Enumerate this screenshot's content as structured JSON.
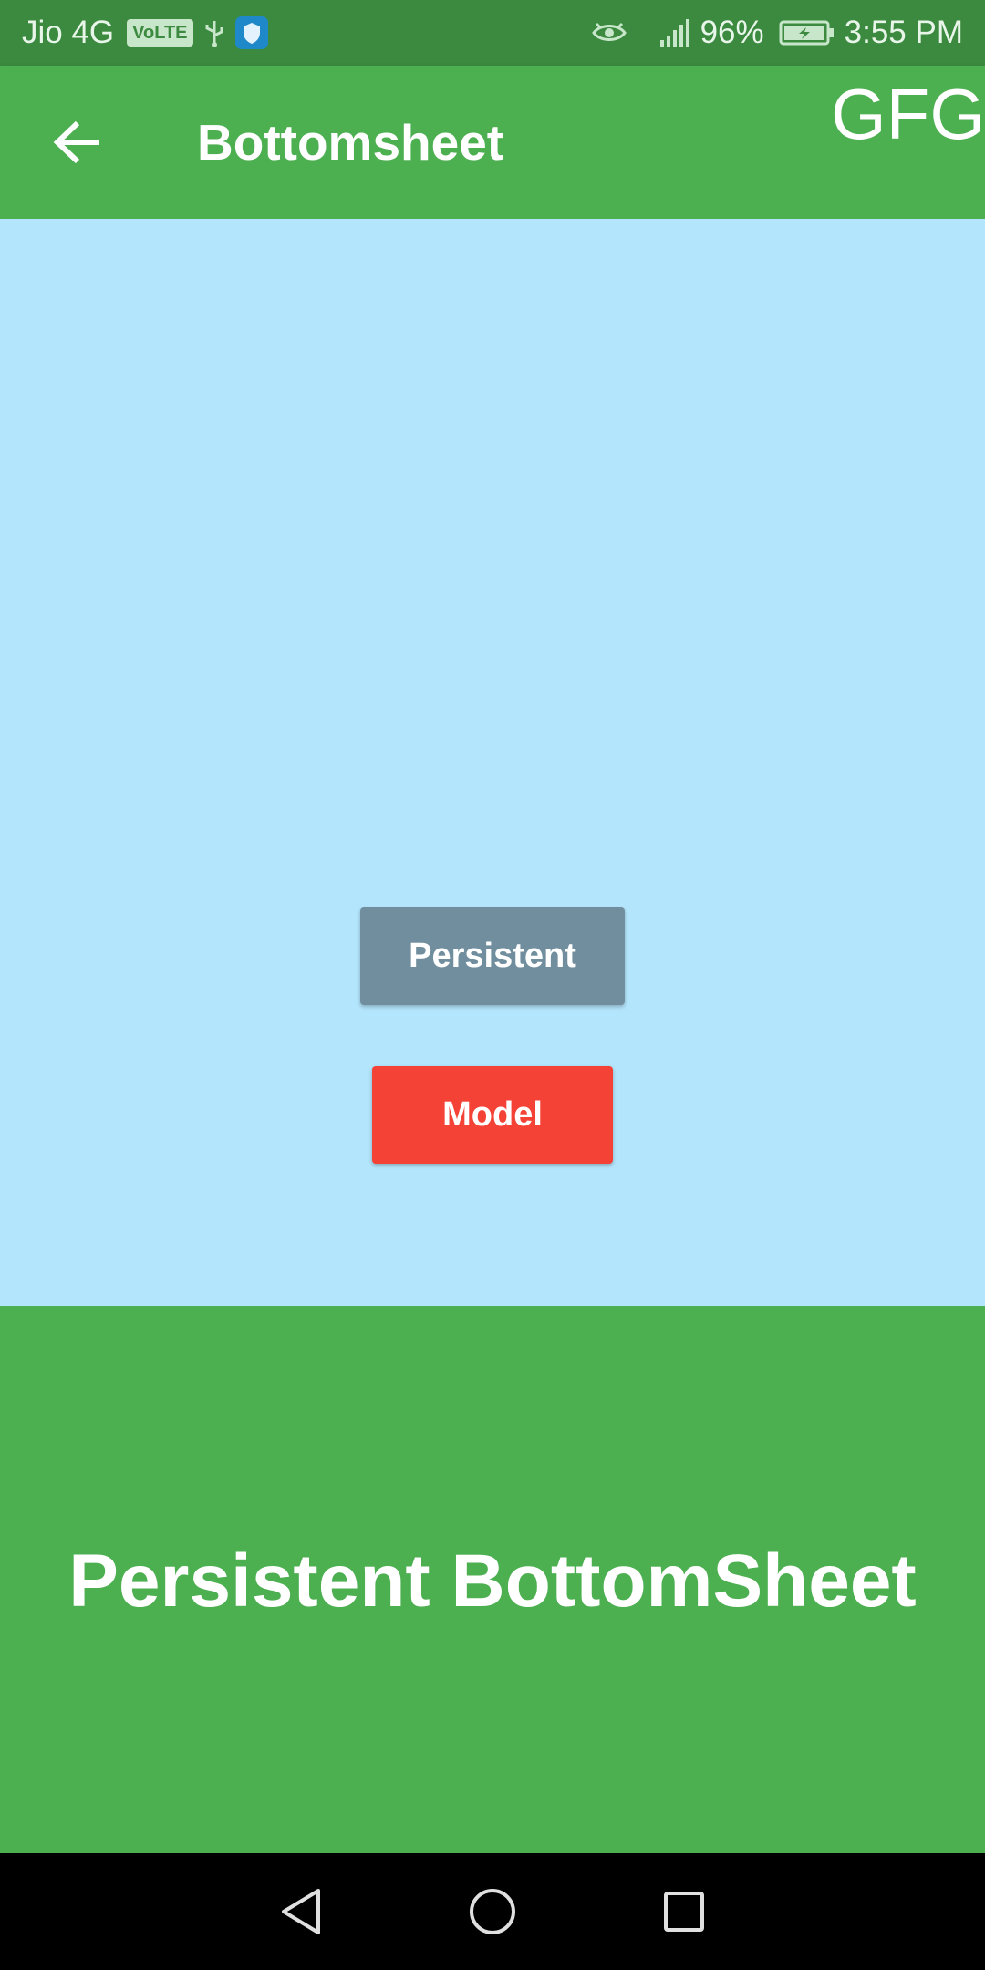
{
  "status_bar": {
    "carrier": "Jio 4G",
    "volte": "VoLTE",
    "battery": "96%",
    "time": "3:55 PM"
  },
  "app_bar": {
    "title": "Bottomsheet",
    "brand": "GFG"
  },
  "buttons": {
    "persistent_label": "Persistent",
    "model_label": "Model"
  },
  "bottom_sheet": {
    "text": "Persistent BottomSheet"
  },
  "colors": {
    "status_bar": "#3b8a40",
    "app_bar": "#4caf50",
    "background": "#b3e5fc",
    "persistent_button": "#718e9e",
    "model_button": "#f44336",
    "bottom_sheet": "#4caf50",
    "nav_bar": "#000000"
  },
  "icons": {
    "usb": "usb-icon",
    "shield": "shield-icon",
    "eye": "eye-icon",
    "signal": "signal-icon",
    "battery": "battery-icon",
    "back": "back-arrow-icon",
    "nav_back": "nav-back-icon",
    "nav_home": "nav-home-icon",
    "nav_recents": "nav-recents-icon"
  }
}
